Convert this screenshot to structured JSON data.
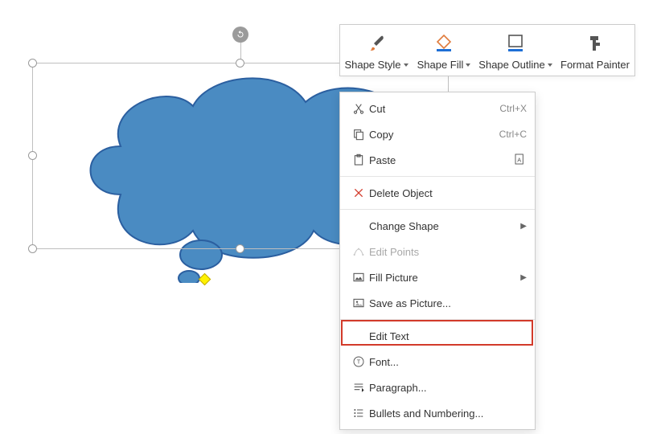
{
  "toolbar": {
    "shape_style": "Shape Style",
    "shape_fill": "Shape Fill",
    "shape_outline": "Shape Outline",
    "format_painter": "Format Painter"
  },
  "contextmenu": {
    "cut": {
      "label": "Cut",
      "accel": "Ctrl+X"
    },
    "copy": {
      "label": "Copy",
      "accel": "Ctrl+C"
    },
    "paste": {
      "label": "Paste"
    },
    "delete_object": "Delete Object",
    "change_shape": "Change Shape",
    "edit_points": "Edit Points",
    "fill_picture": "Fill Picture",
    "save_as_picture": "Save as Picture...",
    "edit_text": "Edit Text",
    "font": "Font...",
    "paragraph": "Paragraph...",
    "bullets": "Bullets and Numbering..."
  },
  "shape": {
    "fill": "#4a8bc2",
    "stroke": "#2b5fa0"
  }
}
